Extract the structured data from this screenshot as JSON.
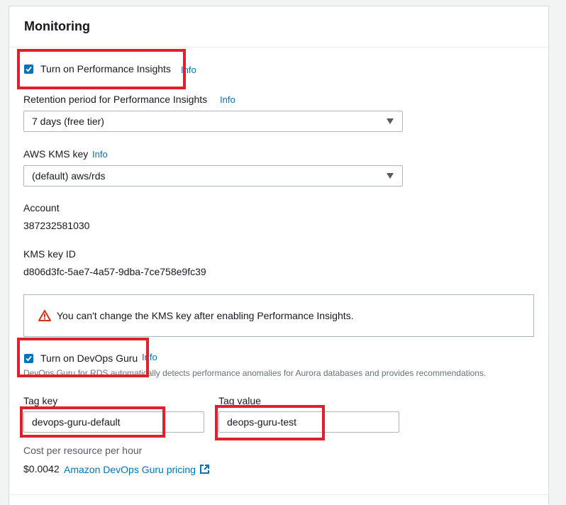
{
  "section": {
    "title": "Monitoring"
  },
  "performance_insights": {
    "checkbox_label": "Turn on Performance Insights",
    "checked": true,
    "info": "Info"
  },
  "retention": {
    "label": "Retention period for Performance Insights",
    "info": "Info",
    "selected": "7 days (free tier)"
  },
  "kms": {
    "label": "AWS KMS key",
    "info": "Info",
    "selected": "(default) aws/rds"
  },
  "account": {
    "label": "Account",
    "value": "387232581030"
  },
  "kms_key_id": {
    "label": "KMS key ID",
    "value": "d806d3fc-5ae7-4a57-9dba-7ce758e9fc39"
  },
  "alert": {
    "message": "You can't change the KMS key after enabling Performance Insights."
  },
  "devops_guru": {
    "checkbox_label": "Turn on DevOps Guru",
    "checked": true,
    "info": "Info",
    "description": "DevOps Guru for RDS automatically detects performance anomalies for Aurora databases and provides recommendations."
  },
  "tag": {
    "key_label": "Tag key",
    "key_value": "devops-guru-default",
    "value_label": "Tag value",
    "value_value": "deops-guru-test"
  },
  "cost": {
    "label": "Cost per resource per hour",
    "price": "$0.0042",
    "link": "Amazon DevOps Guru pricing"
  },
  "colors": {
    "accent": "#0073bb",
    "highlight": "#e0202c",
    "warning": "#d13212"
  }
}
